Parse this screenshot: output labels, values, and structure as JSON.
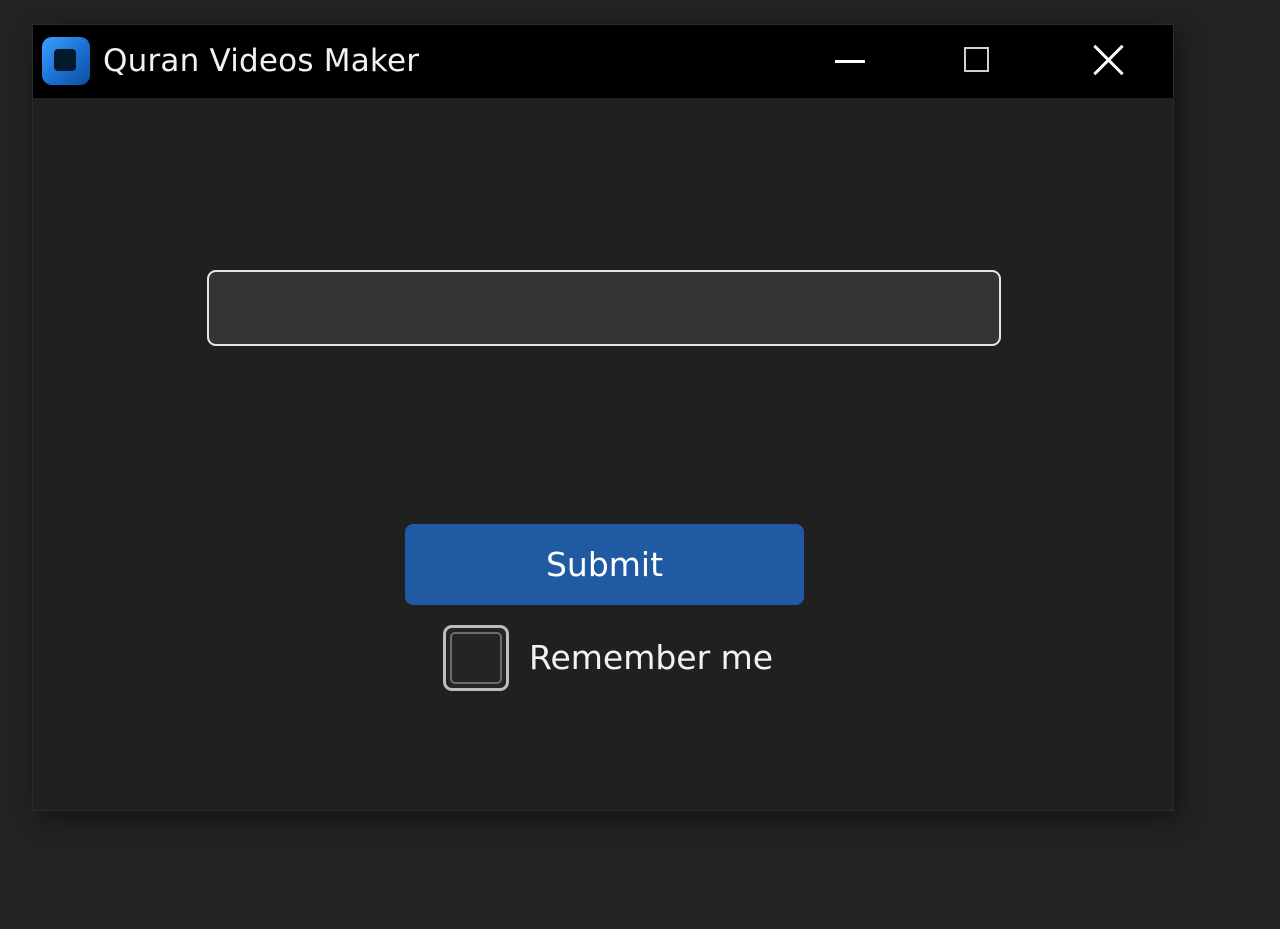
{
  "window": {
    "title": "Quran Videos Maker",
    "controls": {
      "minimize": "minimize-icon",
      "maximize": "maximize-icon",
      "close": "close-icon"
    }
  },
  "form": {
    "input_value": "",
    "input_placeholder": "",
    "submit_label": "Submit",
    "remember_label": "Remember me",
    "remember_checked": false
  },
  "colors": {
    "accent": "#1f5aa3",
    "titlebar": "#000000",
    "background": "#202020",
    "app_icon": "#2a86e8"
  }
}
